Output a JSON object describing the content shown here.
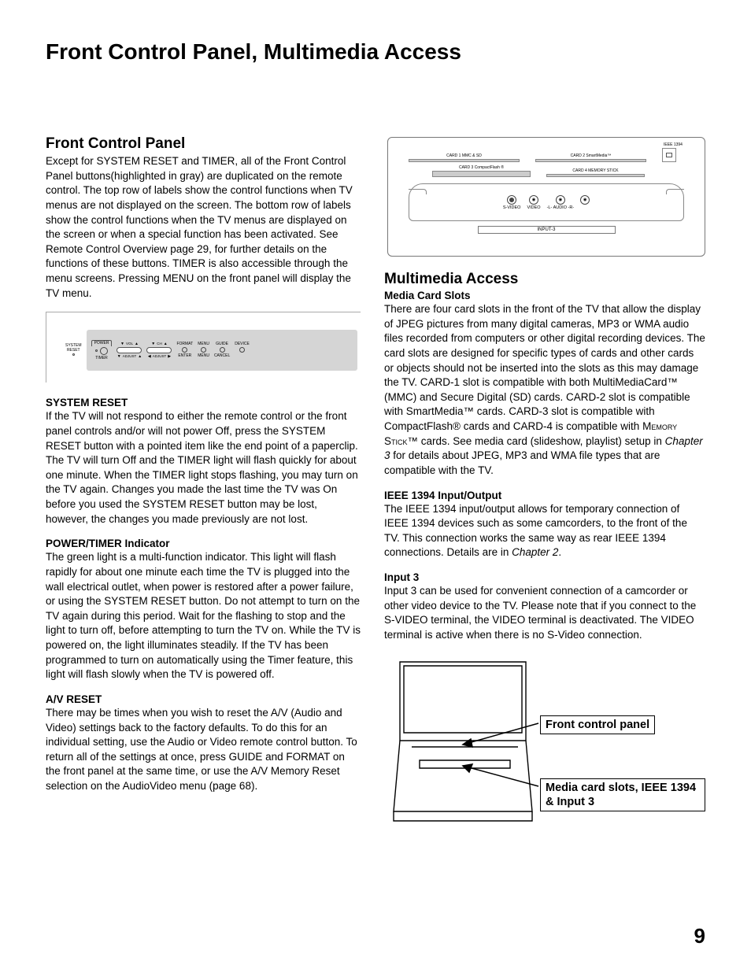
{
  "page_title": "Front Control Panel, Multimedia Access",
  "page_number": "9",
  "left": {
    "h2": "Front Control Panel",
    "intro": "Except for SYSTEM RESET and TIMER, all of the Front Control Panel buttons(highlighted in gray) are duplicated on the remote control.  The top row of labels show the control functions when TV menus are not displayed on the screen.  The bottom row of labels show the control functions when the TV menus are displayed on the screen or when a special function has been activated.  See Remote Control Overview page 29, for further details on the functions of these buttons.  TIMER is also accessible through the menu screens.  Pressing MENU on the front panel will display the TV menu.",
    "diagram": {
      "system_reset": "SYSTEM\nRESET",
      "power": "POWER",
      "timer": "TIMER",
      "vol": "VOL",
      "adjust": "ADJUST",
      "ch": "CH",
      "adjust2": "ADJUST",
      "format": "FORMAT",
      "enter": "ENTER",
      "menu": "MENU",
      "menu2": "MENU",
      "guide": "GUIDE",
      "cancel": "CANCEL",
      "device": "DEVICE"
    },
    "sys_reset_h": "SYSTEM RESET",
    "sys_reset_p": "If the TV will not respond to either the remote control or the front panel controls and/or  will not power Off, press the SYSTEM RESET button with a pointed item like the end point of a paperclip.  The TV will turn Off and the TIMER light will flash quickly for about one minute.  When the TIMER light stops flashing, you may turn on the TV again.  Changes you made the last time the TV was On before you used the SYSTEM RESET button may be lost, however, the changes you made previously are not lost.",
    "pwr_h": "POWER/TIMER Indicator",
    "pwr_p": "The green light is a multi-function indicator.  This light will flash rapidly for about one minute each time the TV is plugged into the wall electrical outlet, when power is restored after a power failure, or using the SYSTEM RESET button.  Do not attempt to turn on the TV again during this period. Wait for the flashing to stop and the light to turn off, before attempting to turn the TV on.  While the TV is powered on, the light illuminates steadily.  If the TV has been programmed to turn on automatically using the Timer feature, this light will flash slowly when the TV is powered off.",
    "av_h": "A/V RESET",
    "av_p": "There may be times when you wish to reset the A/V (Audio and Video) settings back to the factory defaults.  To do this for an individual setting, use the Audio or Video remote control button.  To return all of the settings at once, press GUIDE and FORMAT on the front panel at the same time, or use the A/V Memory Reset selection on the AudioVideo menu (page 68)."
  },
  "right": {
    "diagram": {
      "card1": "CARD 1  MMC & SD",
      "card2": "CARD 2  SmartMedia™",
      "card3": "CARD 3  CompactFlash ®",
      "card4": "CARD 4  MEMORY STICK",
      "ieee": "IEEE 1394",
      "svideo": "S-VIDEO",
      "video": "VIDEO",
      "audio_l": "-L-",
      "audio": "AUDIO",
      "audio_r": "-R-",
      "input3": "INPUT-3"
    },
    "h2": "Multimedia Access",
    "mcs_h": "Media Card Slots",
    "mcs_p1": "There are four card slots in the front of the TV that allow the display of JPEG pictures from many digital cameras, MP3 or WMA audio files recorded from computers or other digital recording devices.  The card slots are designed for specific types of cards and other cards or objects should not be inserted into the slots as this may damage the TV.  CARD-1 slot is compatible with both MultiMediaCard™ (MMC) and Secure Digital (SD) cards.  CARD-2 slot is compatible with SmartMedia™ cards.  CARD-3 slot is compatible with CompactFlash® cards and CARD-4 is compatible with ",
    "memstick": "Memory Stick",
    "mcs_p1b": "™ cards.  See media card (slideshow, playlist) setup in ",
    "ch3a": "Chapter 3",
    "mcs_p1c": " for details about JPEG, MP3 and WMA file types that are compatible with the TV.",
    "ieee_h": "IEEE 1394 Input/Output",
    "ieee_p": "The IEEE 1394 input/output allows for temporary connection of IEEE 1394 devices such as some camcorders, to the front of the TV.  This connection works the same way as rear IEEE 1394 connections.  Details are in ",
    "ch2": "Chapter 2",
    "ieee_p2": ".",
    "in3_h": "Input 3",
    "in3_p": "Input 3 can be used for convenient connection of a camcorder or other video device to the TV.  Please note that if you connect to the S-VIDEO terminal, the VIDEO terminal is deactivated.  The VIDEO terminal is active when there is no S-Video connection.",
    "callout1": "Front control panel",
    "callout2": "Media card slots, IEEE 1394 & Input 3"
  }
}
